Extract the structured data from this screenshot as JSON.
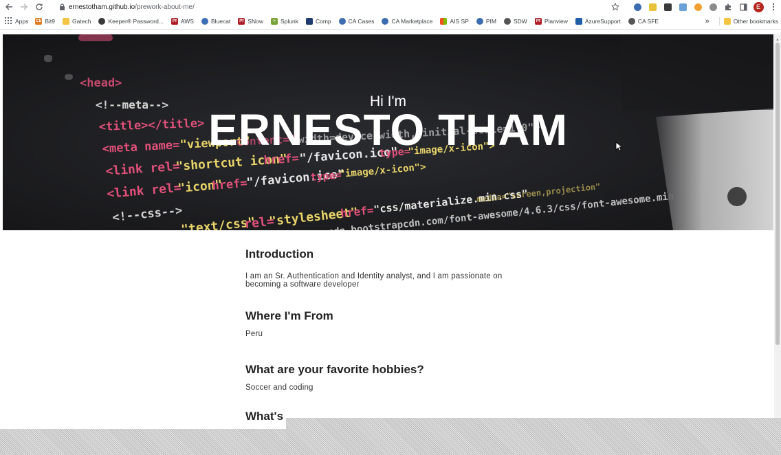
{
  "browser": {
    "url_host": "ernestotham.github.io",
    "url_path": "/prework-about-me/",
    "profile_initial": "E",
    "bookmarks": [
      {
        "label": "Apps",
        "icon": "apps-grid-icon",
        "color": "#ea4335"
      },
      {
        "label": "Bit9",
        "icon": "bit9-icon",
        "color": "#e07b24"
      },
      {
        "label": "Gatech",
        "icon": "folder-icon",
        "color": "#f4c542"
      },
      {
        "label": "Keeper® Password...",
        "icon": "keeper-icon",
        "color": "#3a3a3a"
      },
      {
        "label": "AWS",
        "icon": "pf-icon",
        "color": "#b0202a"
      },
      {
        "label": "Bluecat",
        "icon": "bluecat-icon",
        "color": "#3d6fb6"
      },
      {
        "label": "SNow",
        "icon": "pf-icon",
        "color": "#b0202a"
      },
      {
        "label": "Splunk",
        "icon": "splunk-icon",
        "color": "#7aa33a"
      },
      {
        "label": "Comp",
        "icon": "comp-icon",
        "color": "#1f3b70"
      },
      {
        "label": "CA Cases",
        "icon": "ca-icon",
        "color": "#3c6db0"
      },
      {
        "label": "CA Marketplace",
        "icon": "ca-icon",
        "color": "#3c6db0"
      },
      {
        "label": "AIS SP",
        "icon": "windows-icon",
        "color": "#f25022"
      },
      {
        "label": "PIM",
        "icon": "ca-icon",
        "color": "#3c6db0"
      },
      {
        "label": "SDW",
        "icon": "globe-icon",
        "color": "#555555"
      },
      {
        "label": "Planview",
        "icon": "pf-icon",
        "color": "#b0202a"
      },
      {
        "label": "AzureSupport",
        "icon": "azure-icon",
        "color": "#1f5fa8"
      },
      {
        "label": "CA SFE",
        "icon": "globe-icon",
        "color": "#555555"
      }
    ],
    "more_bookmarks": "»",
    "other_bookmarks": "Other bookmarks"
  },
  "hero": {
    "greeting": "Hi I'm",
    "name": "ERNESTO THAM"
  },
  "sections": [
    {
      "heading": "Introduction",
      "text": "I am an Sr. Authentication and Identity analyst, and I am passionate on becoming a software developer"
    },
    {
      "heading": "Where I'm From",
      "text": "Peru"
    },
    {
      "heading": "What are your favorite hobbies?",
      "text": "Soccer and coding"
    },
    {
      "heading": "What's",
      "text": ""
    }
  ],
  "colors": {
    "hero_bg": "#1e1f22",
    "code_pink": "#e0507a",
    "code_yellow": "#e8d46a",
    "code_white": "#e6e6e6"
  }
}
